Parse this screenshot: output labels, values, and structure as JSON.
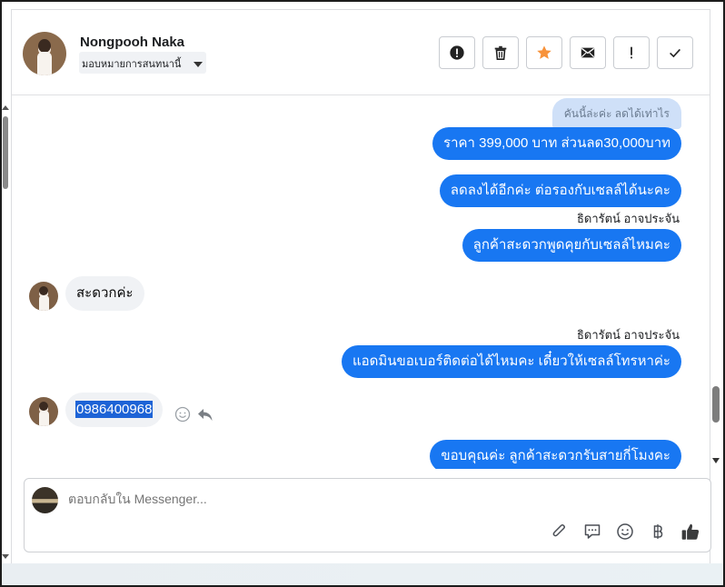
{
  "contact": {
    "name": "Nongpooh Naka",
    "assign_label": "มอบหมายการสนทนานี้"
  },
  "toolbar": {
    "buttons": [
      {
        "name": "spam-icon"
      },
      {
        "name": "trash-icon"
      },
      {
        "name": "star-icon",
        "color": "#f7923a"
      },
      {
        "name": "envelope-icon"
      },
      {
        "name": "follow-up-icon",
        "glyph": "!"
      },
      {
        "name": "check-icon"
      }
    ]
  },
  "messages": {
    "faded_top": "คันนี้ล่ะค่ะ ลดได้เท่าไร",
    "out1": "ราคา 399,000 บาท ส่วนลด30,000บาท",
    "out2": "ลดลงได้อีกค่ะ ต่อรองกับเซลล์ได้นะคะ",
    "sender1": "ธิดารัตน์ อาจประจัน",
    "out3": "ลูกค้าสะดวกพูดคุยกับเซลล์ไหมคะ",
    "in1": "สะดวกค่ะ",
    "sender2": "ธิดารัตน์ อาจประจัน",
    "out4": "แอดมินขอเบอร์ติดต่อได้ไหมคะ เดี๋ยวให้เซลล์โทรหาค่ะ",
    "in2": "0986400968",
    "out5": "ขอบคุณค่ะ ลูกค้าสะดวกรับสายกี่โมงคะ"
  },
  "composer": {
    "placeholder": "ตอบกลับใน Messenger..."
  },
  "colors": {
    "accent": "#1877f2",
    "incoming_bg": "#f0f2f5"
  }
}
